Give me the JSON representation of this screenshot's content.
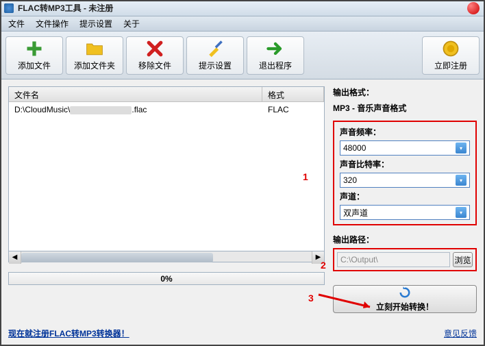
{
  "window": {
    "title": "FLAC转MP3工具 - 未注册"
  },
  "menu": {
    "file": "文件",
    "fileop": "文件操作",
    "hint": "提示设置",
    "about": "关于"
  },
  "toolbar": {
    "add_file": "添加文件",
    "add_folder": "添加文件夹",
    "remove": "移除文件",
    "hint_set": "提示设置",
    "exit": "退出程序",
    "register": "立即注册"
  },
  "filelist": {
    "col_name": "文件名",
    "col_format": "格式",
    "rows": [
      {
        "name_prefix": "D:\\CloudMusic\\",
        "name_suffix": ".flac",
        "format": "FLAC"
      }
    ]
  },
  "progress_text": "0%",
  "output_format": {
    "label": "输出格式：",
    "value": "MP3 - 音乐声音格式"
  },
  "freq": {
    "label": "声音频率：",
    "value": "48000"
  },
  "bitrate": {
    "label": "声音比特率：",
    "value": "320"
  },
  "channel": {
    "label": "声道：",
    "value": "双声道"
  },
  "output_path": {
    "label": "输出路径：",
    "value": "C:\\Output\\",
    "browse": "浏览"
  },
  "start_label": "立刻开始转换！",
  "footer": {
    "register_link": "现在就注册FLAC转MP3转换器！",
    "feedback": "意见反馈"
  },
  "annotations": {
    "one": "1",
    "two": "2",
    "three": "3"
  }
}
